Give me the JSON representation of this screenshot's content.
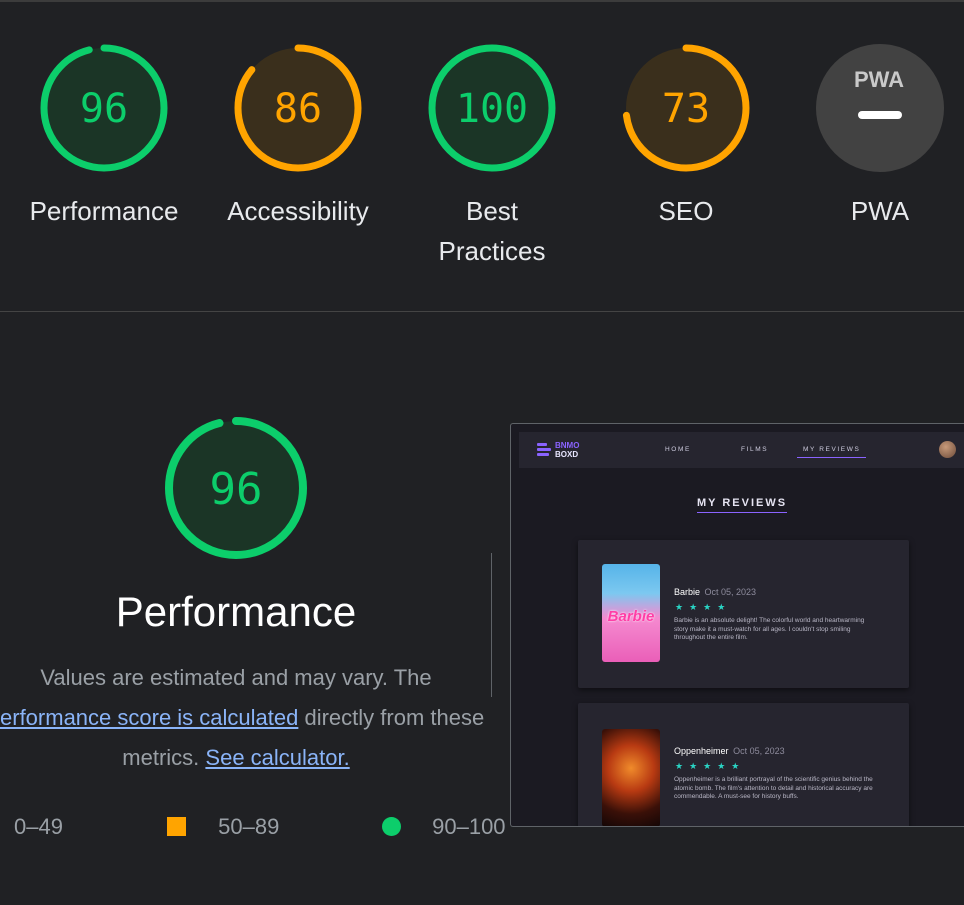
{
  "scores": [
    {
      "label": "Performance",
      "value": "96",
      "score": 96,
      "status": "pass"
    },
    {
      "label": "Accessibility",
      "value": "86",
      "score": 86,
      "status": "average"
    },
    {
      "label_line1": "Best",
      "label_line2": "Practices",
      "value": "100",
      "score": 100,
      "status": "pass"
    },
    {
      "label": "SEO",
      "value": "73",
      "score": 73,
      "status": "average"
    },
    {
      "label": "PWA",
      "badge": "PWA",
      "status": "na"
    }
  ],
  "colors": {
    "pass": "#0cce6b",
    "average": "#ffa400",
    "na_bg": "#424242",
    "link": "#8ab4f8",
    "brand": "#8a63ff",
    "star": "#2ad4c4"
  },
  "main": {
    "value": "96",
    "score": 96,
    "title": "Performance",
    "desc_prefix": "Values are estimated and may vary. The",
    "desc_link": "performance score is calculated",
    "desc_mid": "directly from these metrics.",
    "desc_link2": "See calculator."
  },
  "legend": {
    "fail": "0–49",
    "average": "50–89",
    "pass": "90–100"
  },
  "preview": {
    "logo_line1": "BNMO",
    "logo_line2": "BOXD",
    "nav": [
      "HOME",
      "FILMS",
      "MY REVIEWS"
    ],
    "title": "MY REVIEWS",
    "reviews": [
      {
        "film": "Barbie",
        "date": "Oct 05, 2023",
        "stars": "★★★★",
        "poster_text": "Barbie",
        "body": "Barbie is an absolute delight! The colorful world and heartwarming story make it a must-watch for all ages. I couldn't stop smiling throughout the entire film."
      },
      {
        "film": "Oppenheimer",
        "date": "Oct 05, 2023",
        "stars": "★★★★★",
        "body": "Oppenheimer is a brilliant portrayal of the scientific genius behind the atomic bomb. The film's attention to detail and historical accuracy are commendable. A must-see for history buffs."
      }
    ]
  }
}
